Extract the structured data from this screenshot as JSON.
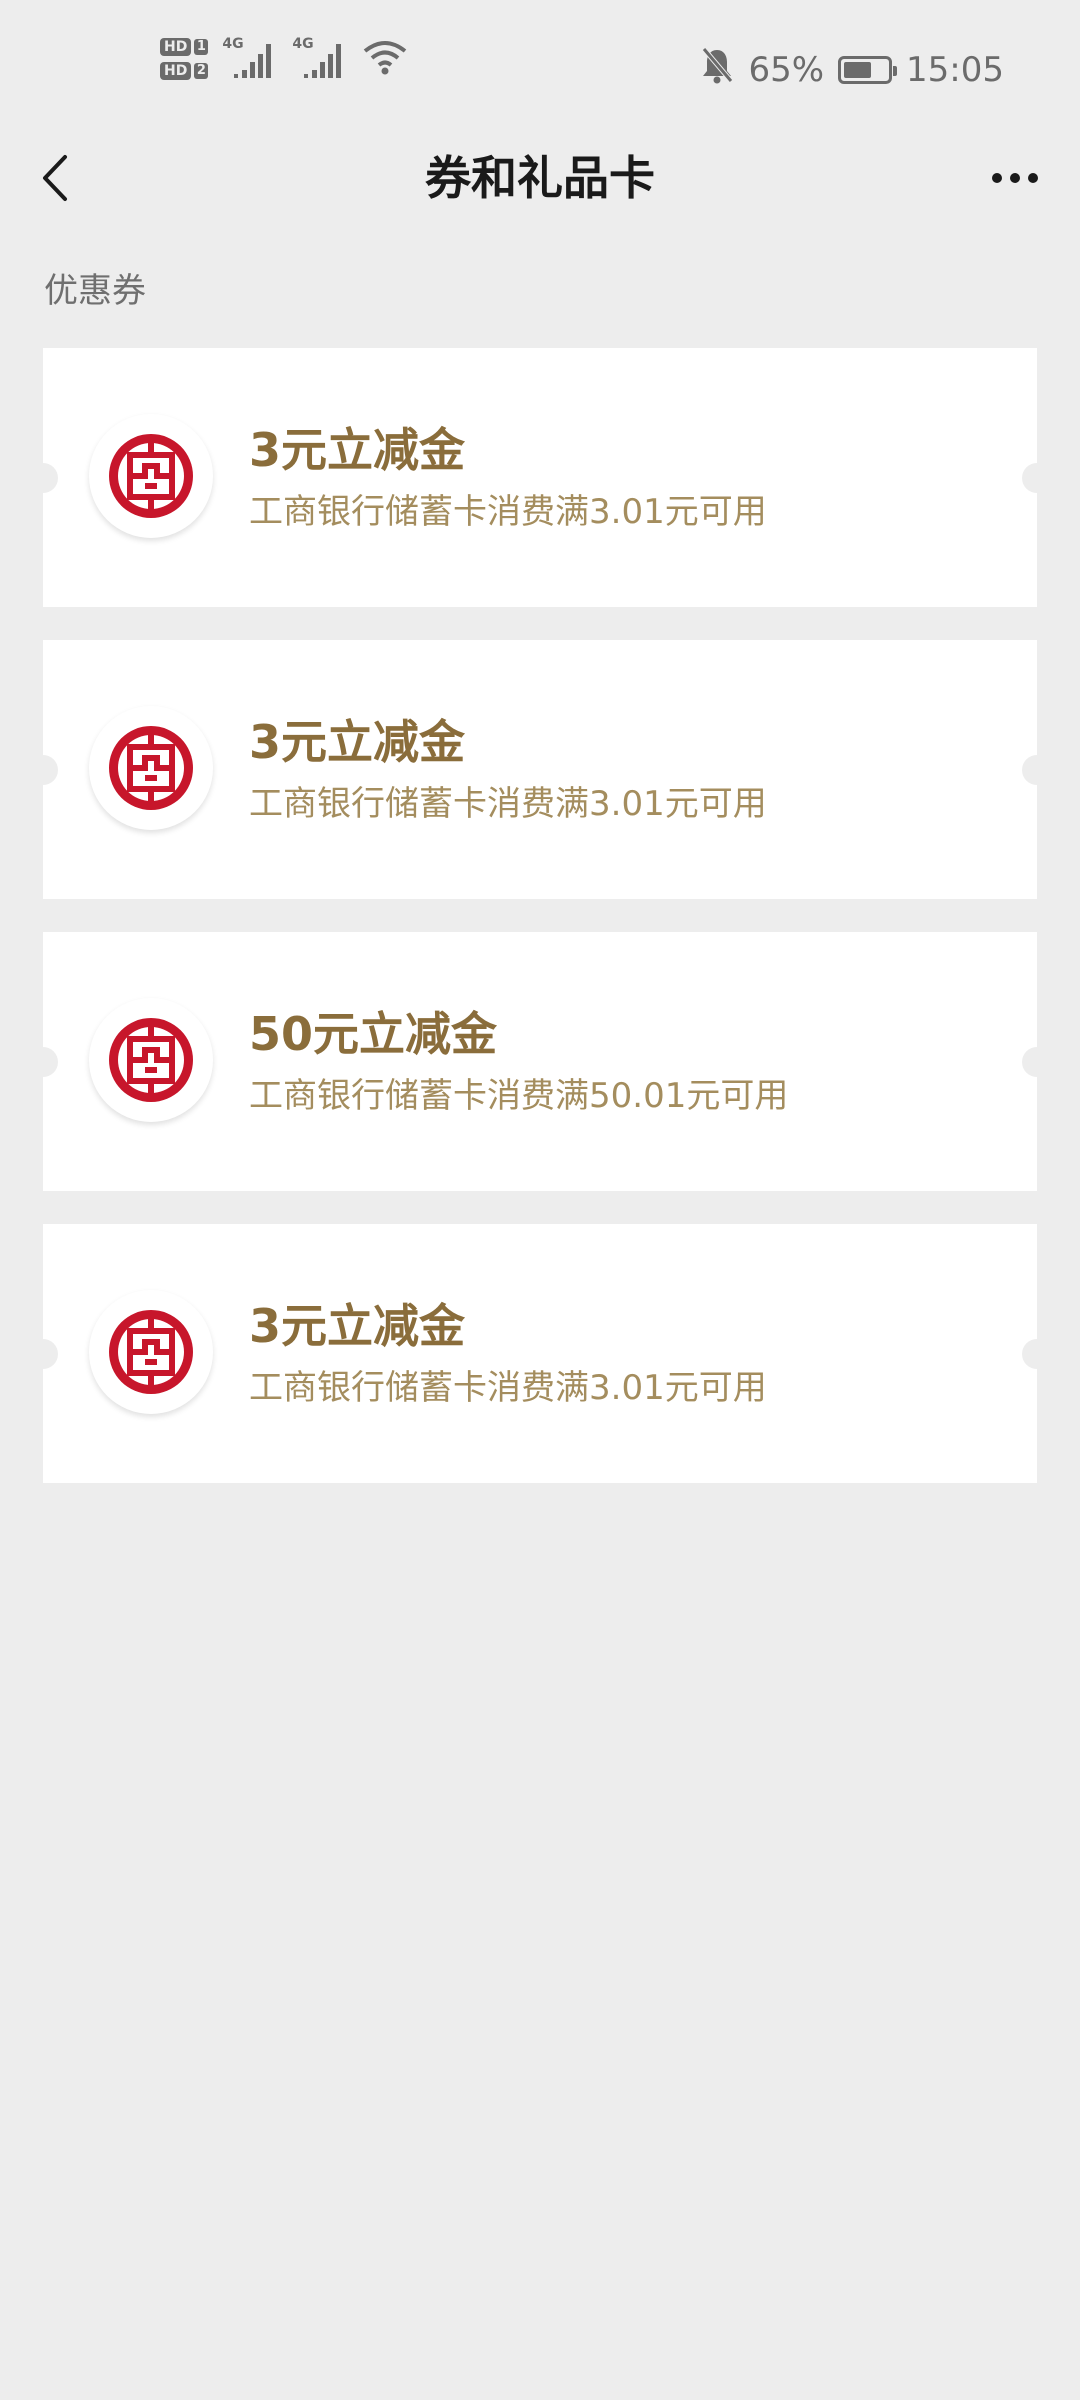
{
  "status_bar": {
    "hd1": "HD",
    "hd1_num": "1",
    "hd2": "HD",
    "hd2_num": "2",
    "net1": "4G",
    "net2": "4G",
    "battery_percent": "65%",
    "battery_level": 0.65,
    "time": "15:05",
    "icons": [
      "signal-icon",
      "signal-icon",
      "wifi-icon",
      "bell-off-icon",
      "battery-icon"
    ]
  },
  "header": {
    "title": "券和礼品卡",
    "back_icon": "chevron-left-icon",
    "more_icon": "more-icon"
  },
  "section": {
    "label": "优惠券"
  },
  "coupons": [
    {
      "title": "3元立减金",
      "desc": "工商银行储蓄卡消费满3.01元可用",
      "logo": "icbc-logo"
    },
    {
      "title": "3元立减金",
      "desc": "工商银行储蓄卡消费满3.01元可用",
      "logo": "icbc-logo"
    },
    {
      "title": "50元立减金",
      "desc": "工商银行储蓄卡消费满50.01元可用",
      "logo": "icbc-logo"
    },
    {
      "title": "3元立减金",
      "desc": "工商银行储蓄卡消费满3.01元可用",
      "logo": "icbc-logo"
    }
  ],
  "colors": {
    "background": "#ededed",
    "card": "#ffffff",
    "coupon_title": "#8a6d3b",
    "coupon_desc": "#a48d5e",
    "icbc_red": "#c7162b"
  }
}
